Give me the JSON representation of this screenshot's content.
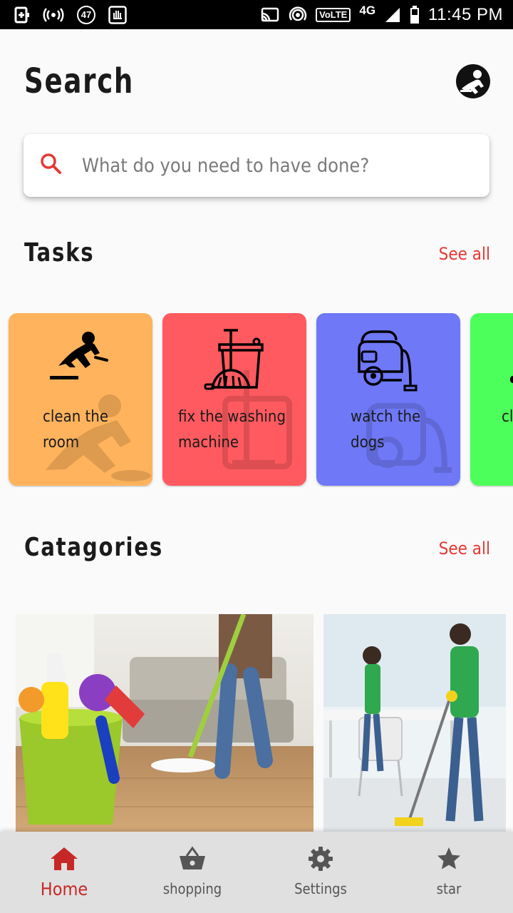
{
  "status_bar": {
    "badge_number": "47",
    "volte": "VoLTE",
    "network": "4G",
    "time": "11:45 PM"
  },
  "header": {
    "title": "Search",
    "avatar_icon": "cleaner-avatar-icon"
  },
  "search": {
    "placeholder": "What do you need to have done?",
    "value": "",
    "icon": "search-icon",
    "accent_color": "#e53935"
  },
  "tasks_section": {
    "title": "Tasks",
    "see_all": "See all",
    "items": [
      {
        "label": "clean the room",
        "color": "#ffb35c",
        "icon": "floor-scrubbing-icon"
      },
      {
        "label": "fix the washing machine",
        "color": "#ff5a5f",
        "icon": "mop-bucket-icon"
      },
      {
        "label": "watch the dogs",
        "color": "#6f78f6",
        "icon": "vacuum-cleaner-icon"
      },
      {
        "label": "cl",
        "color": "#4dff5a",
        "icon": "task-icon"
      }
    ]
  },
  "categories_section": {
    "title": "Catagories",
    "see_all": "See all",
    "items": [
      {
        "image": "cleaning-supplies-bucket-photo"
      },
      {
        "image": "office-cleaning-staff-photo"
      }
    ]
  },
  "bottom_nav": {
    "active_color": "#c62828",
    "items": [
      {
        "label": "Home",
        "icon": "home-icon",
        "active": true
      },
      {
        "label": "shopping",
        "icon": "basket-icon",
        "active": false
      },
      {
        "label": "Settings",
        "icon": "gear-icon",
        "active": false
      },
      {
        "label": "star",
        "icon": "star-icon",
        "active": false
      }
    ]
  }
}
